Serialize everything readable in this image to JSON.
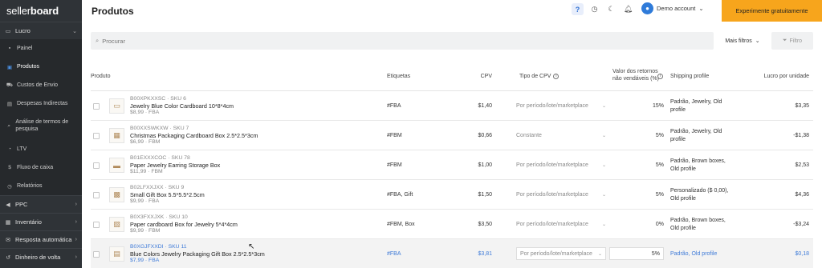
{
  "brand": {
    "logo_light": "seller",
    "logo_bold": "board"
  },
  "sidebar": {
    "groups": [
      {
        "label": "Lucro",
        "icon": "folder-icon"
      },
      {
        "label": "PPC",
        "icon": "megaphone-icon"
      },
      {
        "label": "Inventário",
        "icon": "box-icon"
      },
      {
        "label": "Resposta automática",
        "icon": "mail-icon"
      },
      {
        "label": "Dinheiro de volta",
        "icon": "money-icon"
      }
    ],
    "items": [
      {
        "label": "Painel"
      },
      {
        "label": "Produtos"
      },
      {
        "label": "Custos de Envio"
      },
      {
        "label": "Despesas Indirectas"
      },
      {
        "label": "Análise de termos de pesquisa"
      },
      {
        "label": "LTV"
      },
      {
        "label": "Fluxo de caixa"
      },
      {
        "label": "Relatórios"
      }
    ]
  },
  "header": {
    "title": "Produtos",
    "account": "Demo account",
    "cta": "Experimente gratuitamente"
  },
  "search": {
    "placeholder": "Procurar",
    "more_filters": "Mais filtros",
    "filter": "Filtro"
  },
  "table": {
    "headers": {
      "product": "Produto",
      "tags": "Etiquetas",
      "cpv": "CPV",
      "cpv_type": "Tipo de CPV",
      "returns": "Valor dos retornos não vendáveis (%)",
      "shipping": "Shipping profile",
      "profit": "Lucro por unidade"
    },
    "rows": [
      {
        "sku": "B00XPKXXSC · SKU 6",
        "name": "Jewelry Blue Color Cardboard 10*8*4cm",
        "price": "$8,99 · FBA",
        "tags": "#FBA",
        "cpv": "$1,40",
        "cpv_type": "Por período/lote/marketplace",
        "returns": "15%",
        "shipping": "Padrão, Jewelry, Old profile",
        "profit": "$3,35"
      },
      {
        "sku": "B00XXSWKXW · SKU 7",
        "name": "Christmas Packaging Cardboard Box 2.5*2.5*3cm",
        "price": "$6,99 · FBM",
        "tags": "#FBM",
        "cpv": "$0,66",
        "cpv_type": "Constante",
        "returns": "5%",
        "shipping": "Padrão, Jewelry, Old profile",
        "profit": "-$1,38"
      },
      {
        "sku": "B01EXXXCOC · SKU 78",
        "name": "Paper Jewelry Earring Storage Box",
        "price": "$11,99 · FBM",
        "tags": "#FBM",
        "cpv": "$1,00",
        "cpv_type": "Por período/lote/marketplace",
        "returns": "5%",
        "shipping": "Padrão, Brown boxes, Old profile",
        "profit": "$2,53"
      },
      {
        "sku": "B02LFXXJXX · SKU 9",
        "name": "Small Gift Box 5.5*5.5*2.5cm",
        "price": "$9,99 · FBA",
        "tags": "#FBA, Gift",
        "cpv": "$1,50",
        "cpv_type": "Por período/lote/marketplace",
        "returns": "5%",
        "shipping": "Personalizado ($ 0,00), Old profile",
        "profit": "$4,36"
      },
      {
        "sku": "B0X3FXXJXK · SKU 10",
        "name": "Paper cardboard Box for Jewelry 5*4*4cm",
        "price": "$9,99 · FBM",
        "tags": "#FBM, Box",
        "cpv": "$3,50",
        "cpv_type": "Por período/lote/marketplace",
        "returns": "0%",
        "shipping": "Padrão, Brown boxes, Old profile",
        "profit": "-$3,24"
      },
      {
        "sku": "B0XGJFXXDI · SKU 11",
        "name": "Blue Colors Jewelry Packaging Gift Box 2.5*2.5*3cm",
        "price": "$7,99 · FBA",
        "tags": "#FBA",
        "cpv": "$3,81",
        "cpv_type": "Por período/lote/marketplace",
        "returns": "5%",
        "shipping": "Padrão, Old profile",
        "profit": "$0,18"
      }
    ]
  },
  "colors": {
    "sidebar": "#2f3337",
    "accent": "#f7a51c",
    "link": "#3f7bd8"
  }
}
